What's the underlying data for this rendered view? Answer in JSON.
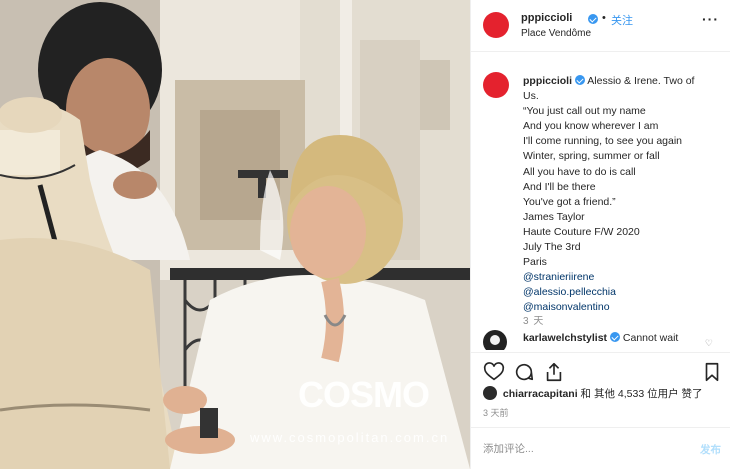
{
  "colors": {
    "brand_avatar": "#e4222e",
    "link_blue": "#3897f0",
    "hashtag": "#003569",
    "muted": "#8e8e8e",
    "post_disabled": "#b2dffc"
  },
  "photo": {
    "watermark": "COSMO",
    "watermark_sub": "www.cosmopolitan.com.cn"
  },
  "header": {
    "username": "pppiccioli",
    "dot": "•",
    "follow_label": "关注",
    "location": "Place Vendôme",
    "more_icon": "more-horizontal-icon"
  },
  "caption": {
    "username": "pppiccioli",
    "lines": [
      "Alessio & Irene. Two of",
      "Us.",
      "“You just call out my name",
      "And you know wherever I am",
      "I'll come running, to see you again",
      "Winter, spring, summer or fall",
      "All you have to do is call",
      "And I'll be there",
      "You've got a friend.”",
      "James Taylor",
      "Haute Couture F/W 2020",
      "July The 3rd",
      "Paris"
    ],
    "tags": [
      "@stranieriirene",
      "@alessio.pellecchia",
      "@maisonvalentino"
    ],
    "time": "3 天"
  },
  "comment": {
    "username": "karlawelchstylist",
    "text": "Cannot wait"
  },
  "actions": {
    "like_icon": "heart-icon",
    "comment_icon": "comment-icon",
    "share_icon": "share-icon",
    "save_icon": "bookmark-icon"
  },
  "likes": {
    "username": "chiarracapitani",
    "text": "和 其他 4,533 位用户 赞了"
  },
  "post_time": "3 天前",
  "comment_input": {
    "placeholder": "添加评论...",
    "post_label": "发布"
  }
}
